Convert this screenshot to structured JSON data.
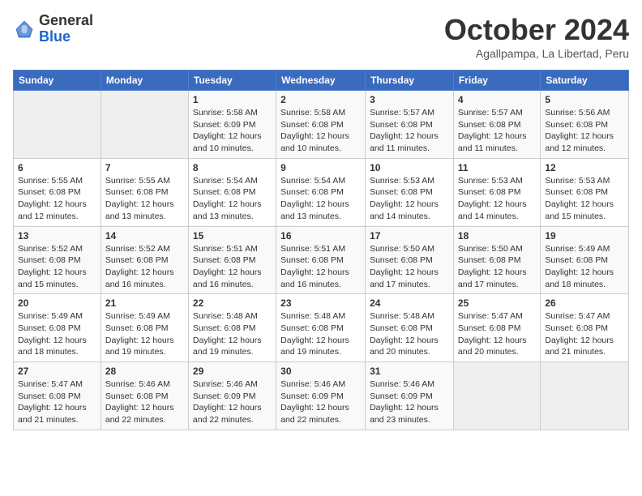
{
  "logo": {
    "general": "General",
    "blue": "Blue"
  },
  "title": "October 2024",
  "location": "Agallpampa, La Libertad, Peru",
  "days_header": [
    "Sunday",
    "Monday",
    "Tuesday",
    "Wednesday",
    "Thursday",
    "Friday",
    "Saturday"
  ],
  "weeks": [
    [
      {
        "day": "",
        "sunrise": "",
        "sunset": "",
        "daylight": ""
      },
      {
        "day": "",
        "sunrise": "",
        "sunset": "",
        "daylight": ""
      },
      {
        "day": "1",
        "sunrise": "Sunrise: 5:58 AM",
        "sunset": "Sunset: 6:09 PM",
        "daylight": "Daylight: 12 hours and 10 minutes."
      },
      {
        "day": "2",
        "sunrise": "Sunrise: 5:58 AM",
        "sunset": "Sunset: 6:08 PM",
        "daylight": "Daylight: 12 hours and 10 minutes."
      },
      {
        "day": "3",
        "sunrise": "Sunrise: 5:57 AM",
        "sunset": "Sunset: 6:08 PM",
        "daylight": "Daylight: 12 hours and 11 minutes."
      },
      {
        "day": "4",
        "sunrise": "Sunrise: 5:57 AM",
        "sunset": "Sunset: 6:08 PM",
        "daylight": "Daylight: 12 hours and 11 minutes."
      },
      {
        "day": "5",
        "sunrise": "Sunrise: 5:56 AM",
        "sunset": "Sunset: 6:08 PM",
        "daylight": "Daylight: 12 hours and 12 minutes."
      }
    ],
    [
      {
        "day": "6",
        "sunrise": "Sunrise: 5:55 AM",
        "sunset": "Sunset: 6:08 PM",
        "daylight": "Daylight: 12 hours and 12 minutes."
      },
      {
        "day": "7",
        "sunrise": "Sunrise: 5:55 AM",
        "sunset": "Sunset: 6:08 PM",
        "daylight": "Daylight: 12 hours and 13 minutes."
      },
      {
        "day": "8",
        "sunrise": "Sunrise: 5:54 AM",
        "sunset": "Sunset: 6:08 PM",
        "daylight": "Daylight: 12 hours and 13 minutes."
      },
      {
        "day": "9",
        "sunrise": "Sunrise: 5:54 AM",
        "sunset": "Sunset: 6:08 PM",
        "daylight": "Daylight: 12 hours and 13 minutes."
      },
      {
        "day": "10",
        "sunrise": "Sunrise: 5:53 AM",
        "sunset": "Sunset: 6:08 PM",
        "daylight": "Daylight: 12 hours and 14 minutes."
      },
      {
        "day": "11",
        "sunrise": "Sunrise: 5:53 AM",
        "sunset": "Sunset: 6:08 PM",
        "daylight": "Daylight: 12 hours and 14 minutes."
      },
      {
        "day": "12",
        "sunrise": "Sunrise: 5:53 AM",
        "sunset": "Sunset: 6:08 PM",
        "daylight": "Daylight: 12 hours and 15 minutes."
      }
    ],
    [
      {
        "day": "13",
        "sunrise": "Sunrise: 5:52 AM",
        "sunset": "Sunset: 6:08 PM",
        "daylight": "Daylight: 12 hours and 15 minutes."
      },
      {
        "day": "14",
        "sunrise": "Sunrise: 5:52 AM",
        "sunset": "Sunset: 6:08 PM",
        "daylight": "Daylight: 12 hours and 16 minutes."
      },
      {
        "day": "15",
        "sunrise": "Sunrise: 5:51 AM",
        "sunset": "Sunset: 6:08 PM",
        "daylight": "Daylight: 12 hours and 16 minutes."
      },
      {
        "day": "16",
        "sunrise": "Sunrise: 5:51 AM",
        "sunset": "Sunset: 6:08 PM",
        "daylight": "Daylight: 12 hours and 16 minutes."
      },
      {
        "day": "17",
        "sunrise": "Sunrise: 5:50 AM",
        "sunset": "Sunset: 6:08 PM",
        "daylight": "Daylight: 12 hours and 17 minutes."
      },
      {
        "day": "18",
        "sunrise": "Sunrise: 5:50 AM",
        "sunset": "Sunset: 6:08 PM",
        "daylight": "Daylight: 12 hours and 17 minutes."
      },
      {
        "day": "19",
        "sunrise": "Sunrise: 5:49 AM",
        "sunset": "Sunset: 6:08 PM",
        "daylight": "Daylight: 12 hours and 18 minutes."
      }
    ],
    [
      {
        "day": "20",
        "sunrise": "Sunrise: 5:49 AM",
        "sunset": "Sunset: 6:08 PM",
        "daylight": "Daylight: 12 hours and 18 minutes."
      },
      {
        "day": "21",
        "sunrise": "Sunrise: 5:49 AM",
        "sunset": "Sunset: 6:08 PM",
        "daylight": "Daylight: 12 hours and 19 minutes."
      },
      {
        "day": "22",
        "sunrise": "Sunrise: 5:48 AM",
        "sunset": "Sunset: 6:08 PM",
        "daylight": "Daylight: 12 hours and 19 minutes."
      },
      {
        "day": "23",
        "sunrise": "Sunrise: 5:48 AM",
        "sunset": "Sunset: 6:08 PM",
        "daylight": "Daylight: 12 hours and 19 minutes."
      },
      {
        "day": "24",
        "sunrise": "Sunrise: 5:48 AM",
        "sunset": "Sunset: 6:08 PM",
        "daylight": "Daylight: 12 hours and 20 minutes."
      },
      {
        "day": "25",
        "sunrise": "Sunrise: 5:47 AM",
        "sunset": "Sunset: 6:08 PM",
        "daylight": "Daylight: 12 hours and 20 minutes."
      },
      {
        "day": "26",
        "sunrise": "Sunrise: 5:47 AM",
        "sunset": "Sunset: 6:08 PM",
        "daylight": "Daylight: 12 hours and 21 minutes."
      }
    ],
    [
      {
        "day": "27",
        "sunrise": "Sunrise: 5:47 AM",
        "sunset": "Sunset: 6:08 PM",
        "daylight": "Daylight: 12 hours and 21 minutes."
      },
      {
        "day": "28",
        "sunrise": "Sunrise: 5:46 AM",
        "sunset": "Sunset: 6:08 PM",
        "daylight": "Daylight: 12 hours and 22 minutes."
      },
      {
        "day": "29",
        "sunrise": "Sunrise: 5:46 AM",
        "sunset": "Sunset: 6:09 PM",
        "daylight": "Daylight: 12 hours and 22 minutes."
      },
      {
        "day": "30",
        "sunrise": "Sunrise: 5:46 AM",
        "sunset": "Sunset: 6:09 PM",
        "daylight": "Daylight: 12 hours and 22 minutes."
      },
      {
        "day": "31",
        "sunrise": "Sunrise: 5:46 AM",
        "sunset": "Sunset: 6:09 PM",
        "daylight": "Daylight: 12 hours and 23 minutes."
      },
      {
        "day": "",
        "sunrise": "",
        "sunset": "",
        "daylight": ""
      },
      {
        "day": "",
        "sunrise": "",
        "sunset": "",
        "daylight": ""
      }
    ]
  ]
}
